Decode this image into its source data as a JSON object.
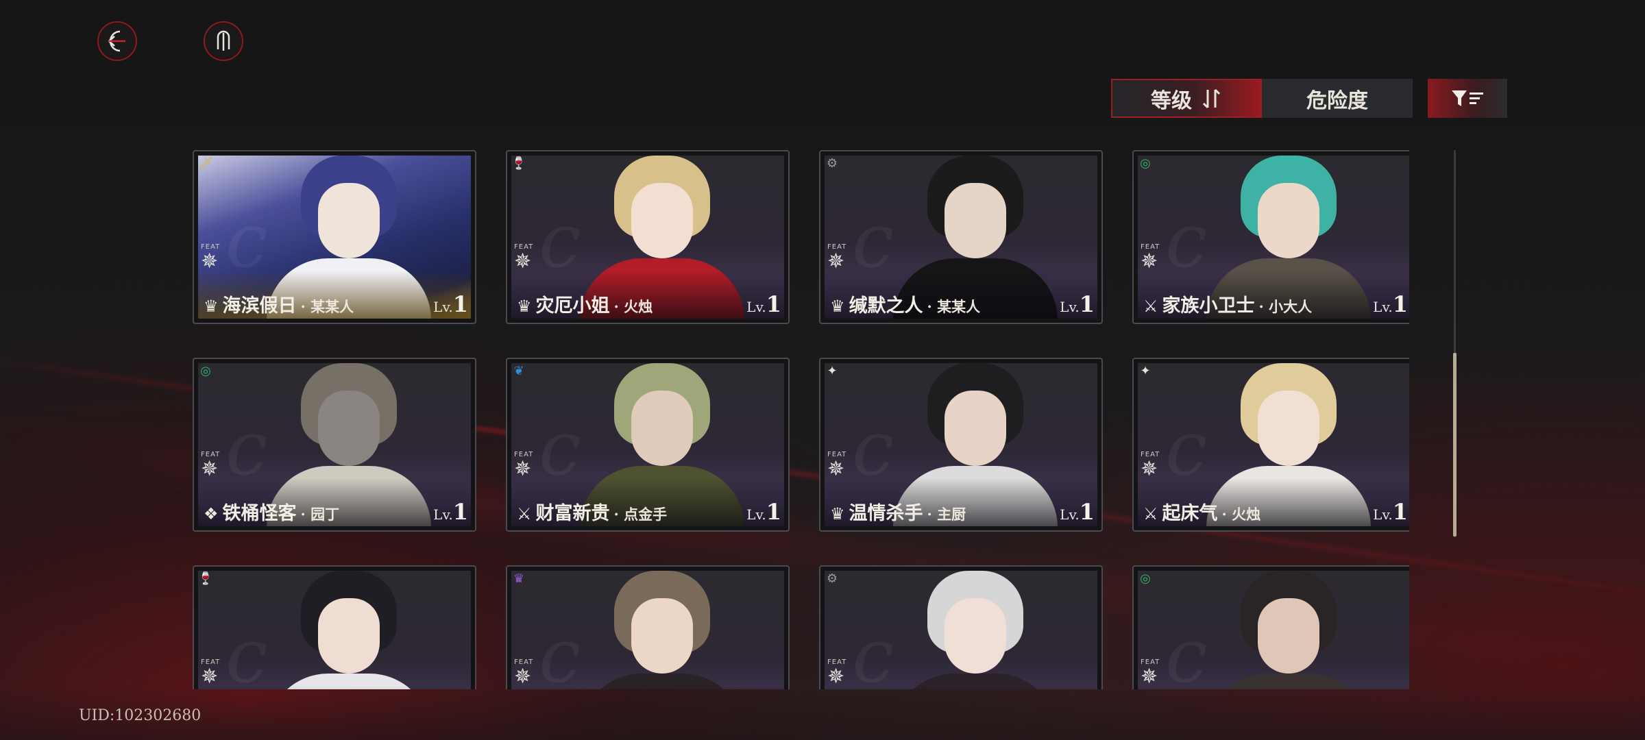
{
  "toolbar": {
    "back_icon": "back-arrow-icon",
    "menu_icon": "trident-menu-icon"
  },
  "sort": {
    "level_label": "等级",
    "danger_label": "危险度",
    "active": "level",
    "filter_icon": "filter-icon"
  },
  "colors": {
    "accent": "#9b1e24",
    "card_border": "#4c4a50",
    "scroll_thumb": "#b7ad97"
  },
  "cards": [
    {
      "type_icon": "dagger-icon",
      "type_color": "#d8b340",
      "feat_label": "FEAT",
      "role_icon": "crown-icon",
      "title": "海滨假日",
      "char": "· 某某人",
      "level_prefix": "Lv.",
      "level": "1",
      "style": "gold"
    },
    {
      "type_icon": "goblet-icon",
      "type_color": "#d2303a",
      "feat_label": "FEAT",
      "role_icon": "crown-icon",
      "title": "灾厄小姐",
      "char": "· 火烛",
      "level_prefix": "Lv.",
      "level": "1",
      "style": "normal"
    },
    {
      "type_icon": "gear-icon",
      "type_color": "#9a9aa0",
      "feat_label": "FEAT",
      "role_icon": "crown-icon",
      "title": "缄默之人",
      "char": "· 某某人",
      "level_prefix": "Lv.",
      "level": "1",
      "style": "normal"
    },
    {
      "type_icon": "swirl-icon",
      "type_color": "#2fb26a",
      "feat_label": "FEAT",
      "role_icon": "swords-icon",
      "title": "家族小卫士",
      "char": "· 小大人",
      "level_prefix": "Lv.",
      "level": "1",
      "style": "normal"
    },
    {
      "type_icon": "swirl-icon",
      "type_color": "#2fb26a",
      "feat_label": "FEAT",
      "role_icon": "wings-icon",
      "title": "铁桶怪客",
      "char": "· 园丁",
      "level_prefix": "Lv.",
      "level": "1",
      "style": "normal"
    },
    {
      "type_icon": "feather-icon",
      "type_color": "#2d8fd8",
      "feat_label": "FEAT",
      "role_icon": "swords-icon",
      "title": "财富新贵",
      "char": "· 点金手",
      "level_prefix": "Lv.",
      "level": "1",
      "style": "normal"
    },
    {
      "type_icon": "butterfly-icon",
      "type_color": "#e8e4dc",
      "feat_label": "FEAT",
      "role_icon": "crown-icon",
      "title": "温情杀手",
      "char": "· 主厨",
      "level_prefix": "Lv.",
      "level": "1",
      "style": "normal"
    },
    {
      "type_icon": "butterfly-icon",
      "type_color": "#e8e4dc",
      "feat_label": "FEAT",
      "role_icon": "swords-icon",
      "title": "起床气",
      "char": "· 火烛",
      "level_prefix": "Lv.",
      "level": "1",
      "style": "normal"
    },
    {
      "type_icon": "goblet-icon",
      "type_color": "#d2303a",
      "feat_label": "FEAT",
      "style": "normal"
    },
    {
      "type_icon": "crown-icon",
      "type_color": "#9b5ad8",
      "feat_label": "FEAT",
      "style": "normal"
    },
    {
      "type_icon": "gear-icon",
      "type_color": "#9a9aa0",
      "feat_label": "FEAT",
      "style": "normal"
    },
    {
      "type_icon": "swirl-icon",
      "type_color": "#2fb26a",
      "feat_label": "FEAT",
      "style": "normal"
    }
  ],
  "uid": "UID:102302680"
}
